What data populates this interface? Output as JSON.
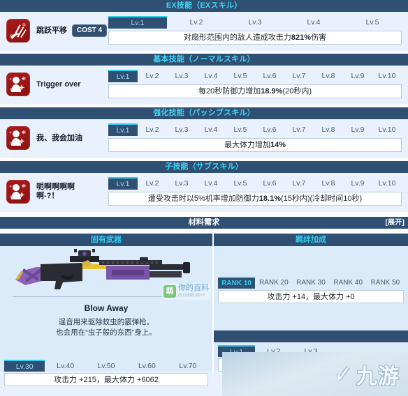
{
  "sections": [
    {
      "header": "EX技能（EXスキル）",
      "skill": {
        "icon": "ex-skill-impact-icon",
        "name": "跳跃平移",
        "cost": "COST 4",
        "levels": [
          "Lv.1",
          "Lv.2",
          "Lv.3",
          "Lv.4",
          "Lv.5"
        ],
        "active_level": "Lv.1",
        "description_pre": "对扇形范围内的敌人造成攻击力",
        "description_bold": "821%",
        "description_post": "伤害"
      }
    },
    {
      "header": "基本技能（ノーマルスキル）",
      "skill": {
        "icon": "normal-skill-snowgirl-icon",
        "name": "Trigger over",
        "cost": "",
        "levels": [
          "Lv.1",
          "Lv.2",
          "Lv.3",
          "Lv.4",
          "Lv.5",
          "Lv.6",
          "Lv.7",
          "Lv.8",
          "Lv.9",
          "Lv.10"
        ],
        "active_level": "Lv.1",
        "description_pre": "每20秒防御力增加",
        "description_bold": "18.9%",
        "description_post": "(20秒内)"
      }
    },
    {
      "header": "强化技能（パッシブスキル）",
      "skill": {
        "icon": "passive-skill-snowgirl-icon",
        "name": "我、我会加油",
        "cost": "",
        "levels": [
          "Lv.1",
          "Lv.2",
          "Lv.3",
          "Lv.4",
          "Lv.5",
          "Lv.6",
          "Lv.7",
          "Lv.8",
          "Lv.9",
          "Lv.10"
        ],
        "active_level": "Lv.1",
        "description_pre": "最大体力增加",
        "description_bold": "14%",
        "description_post": ""
      }
    },
    {
      "header": "子技能（サブスキル）",
      "skill": {
        "icon": "sub-skill-snowgirl-icon",
        "name": "呃啊啊啊啊啊-?！",
        "cost": "",
        "levels": [
          "Lv.1",
          "Lv.2",
          "Lv.3",
          "Lv.4",
          "Lv.5",
          "Lv.6",
          "Lv.7",
          "Lv.8",
          "Lv.9",
          "Lv.10"
        ],
        "active_level": "Lv.1",
        "description_pre": "遭受攻击时以5%机率增加防御力",
        "description_bold": "18.1%",
        "description_post": "(15秒内)(冷却时间10秒)"
      }
    }
  ],
  "material": {
    "title": "材料需求",
    "expand": "[展开]"
  },
  "columns": {
    "weapon_header": "固有武器",
    "bond_header": "羁绊加成"
  },
  "weapon": {
    "name": "Blow Away",
    "desc_line1": "逞音用来驱除蚊虫的霰弹枪。",
    "desc_line2": "也会用在“虫子般的东西”身上。",
    "levels": [
      "Lv.30",
      "Lv.40",
      "Lv.50",
      "Lv.60",
      "Lv.70"
    ],
    "active_level": "Lv.30",
    "stats": "攻击力 +215，最大体力 +6062",
    "image_alt": "purple-black-shotgun"
  },
  "bond": {
    "ranks": [
      "RANK 10",
      "RANK 20",
      "RANK 30",
      "RANK 40",
      "RANK 50"
    ],
    "active_rank": "RANK 10",
    "stats": "攻击力 +14，最大体力 +0"
  },
  "bottom_right": {
    "header": "",
    "levels": [
      "Lv.1",
      "Lv.2",
      "Lv.3"
    ],
    "active_level": "Lv.1"
  },
  "watermarks": {
    "moegirl_badge": "萌",
    "moegirl_text": "你的百科",
    "moegirl_sub": "zh.moegirl.org.cn",
    "jiuyou_text": "九游"
  },
  "colors": {
    "bar_bg": "#2f4f73",
    "bar_text": "#3fd6f5",
    "body_bg": "#e9f2fc",
    "panel_bg": "#dcebfa",
    "accent_cyan": "#2ad2f0",
    "icon_red": "#9c1616"
  }
}
